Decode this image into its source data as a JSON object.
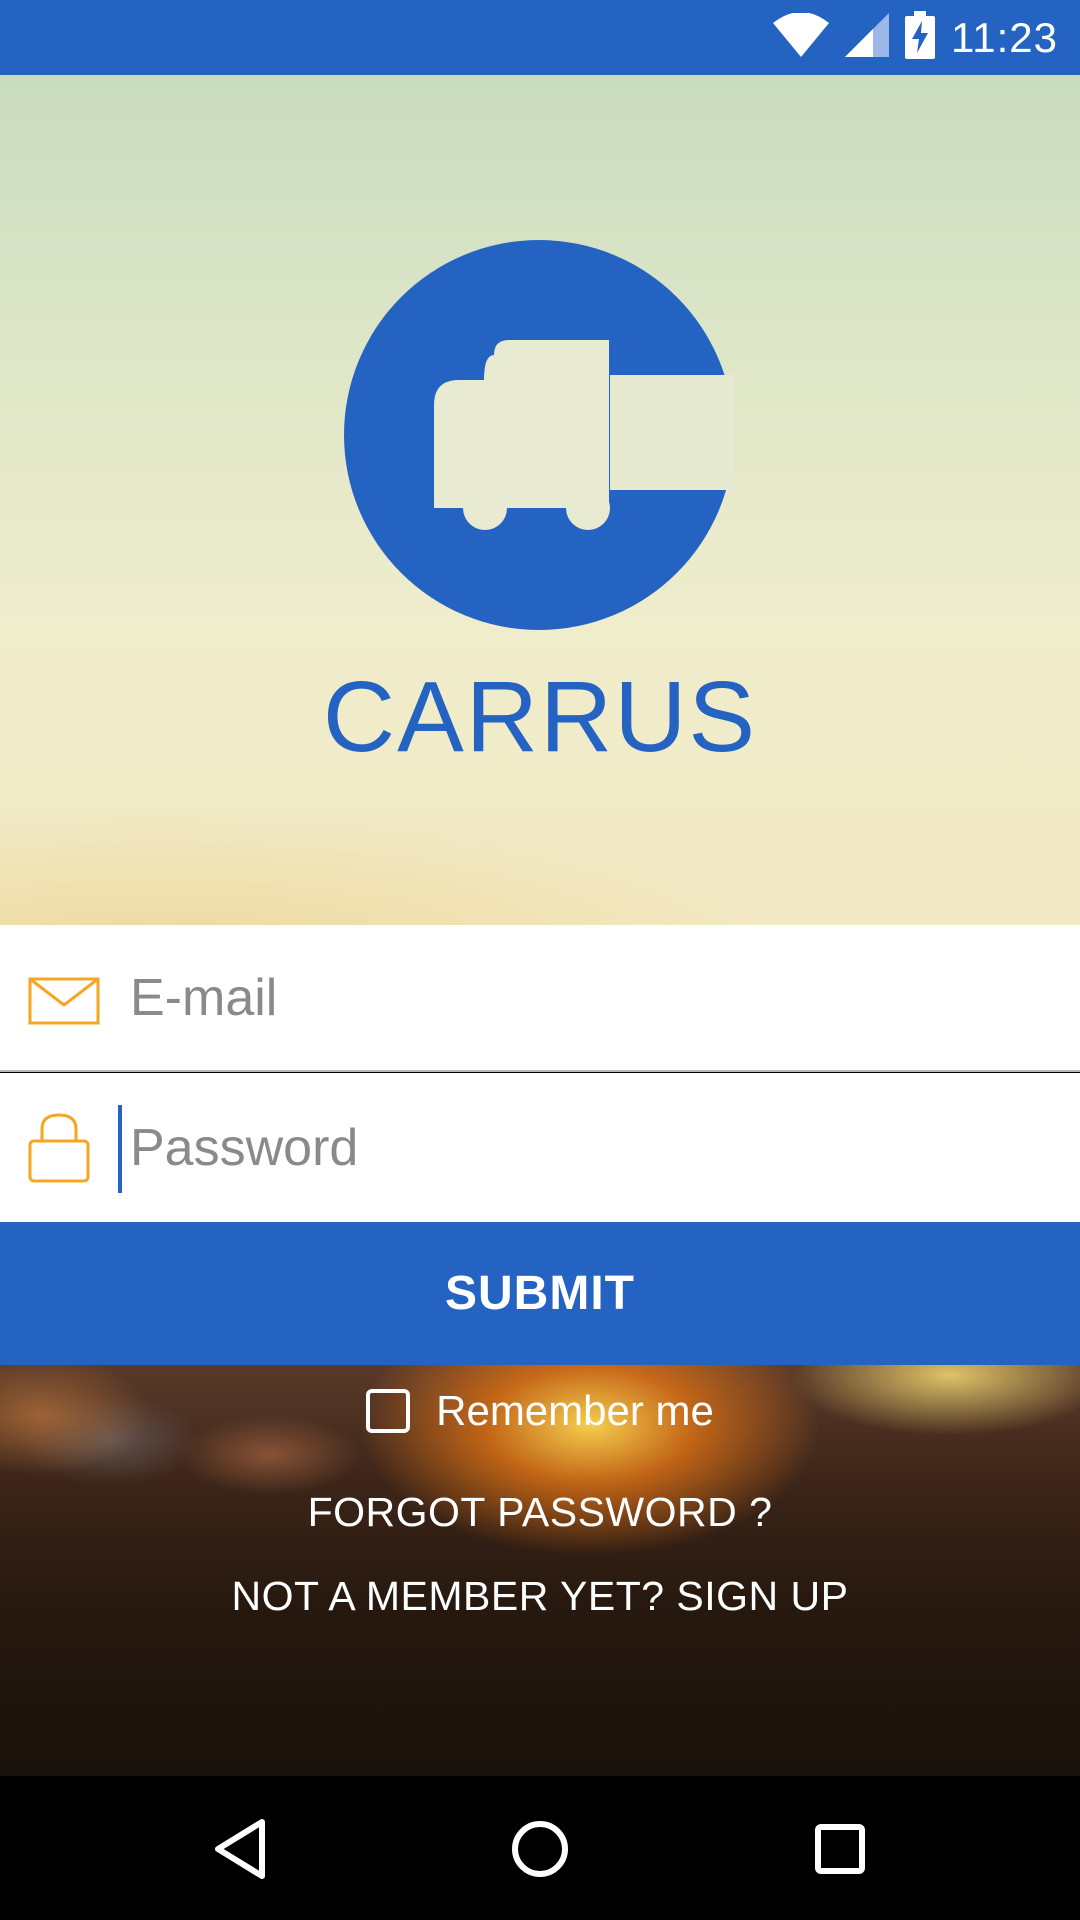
{
  "status_bar": {
    "time": "11:23",
    "icons": [
      "wifi-icon",
      "cell-signal-icon",
      "battery-charging-icon"
    ],
    "background": "#2563c3"
  },
  "app": {
    "brand": "CARRUS",
    "logo_icon": "truck-c-logo-icon",
    "accent_color": "#2563c3",
    "field_icon_color": "#f5a623"
  },
  "form": {
    "email": {
      "placeholder": "E-mail",
      "value": "",
      "icon": "envelope-icon"
    },
    "password": {
      "placeholder": "Password",
      "value": "",
      "icon": "lock-icon"
    },
    "submit_label": "SUBMIT"
  },
  "options": {
    "remember_label": "Remember me",
    "remember_checked": false,
    "forgot_label": "FORGOT PASSWORD ?",
    "signup_label": "NOT A MEMBER YET? SIGN UP"
  },
  "nav_bar": {
    "buttons": [
      "back-icon",
      "home-icon",
      "recents-icon"
    ]
  }
}
